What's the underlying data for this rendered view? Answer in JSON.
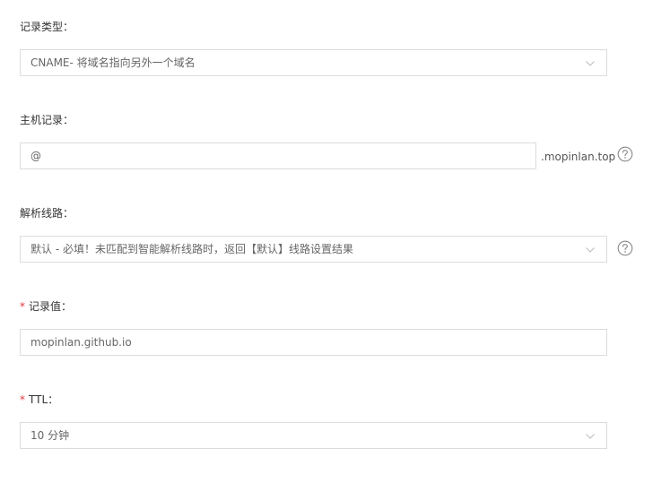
{
  "record_type": {
    "label": "记录类型：",
    "value": "CNAME- 将域名指向另外一个域名",
    "icon": "chevron-down-icon"
  },
  "host_record": {
    "label": "主机记录：",
    "value": "@",
    "suffix": ".mopinlan.top",
    "help_icon": "question-circle-icon"
  },
  "resolve_line": {
    "label": "解析线路：",
    "value": "默认 - 必填！未匹配到智能解析线路时，返回【默认】线路设置结果",
    "icon": "chevron-down-icon",
    "help_icon": "question-circle-icon"
  },
  "record_value": {
    "required_mark": "*",
    "label": "记录值：",
    "value": "mopinlan.github.io"
  },
  "ttl": {
    "required_mark": "*",
    "label": "TTL：",
    "value": "10 分钟",
    "icon": "chevron-down-icon"
  },
  "colors": {
    "border": "#dcdcdc",
    "required": "#e4393c",
    "text": "#333333",
    "field_text": "#666666"
  }
}
